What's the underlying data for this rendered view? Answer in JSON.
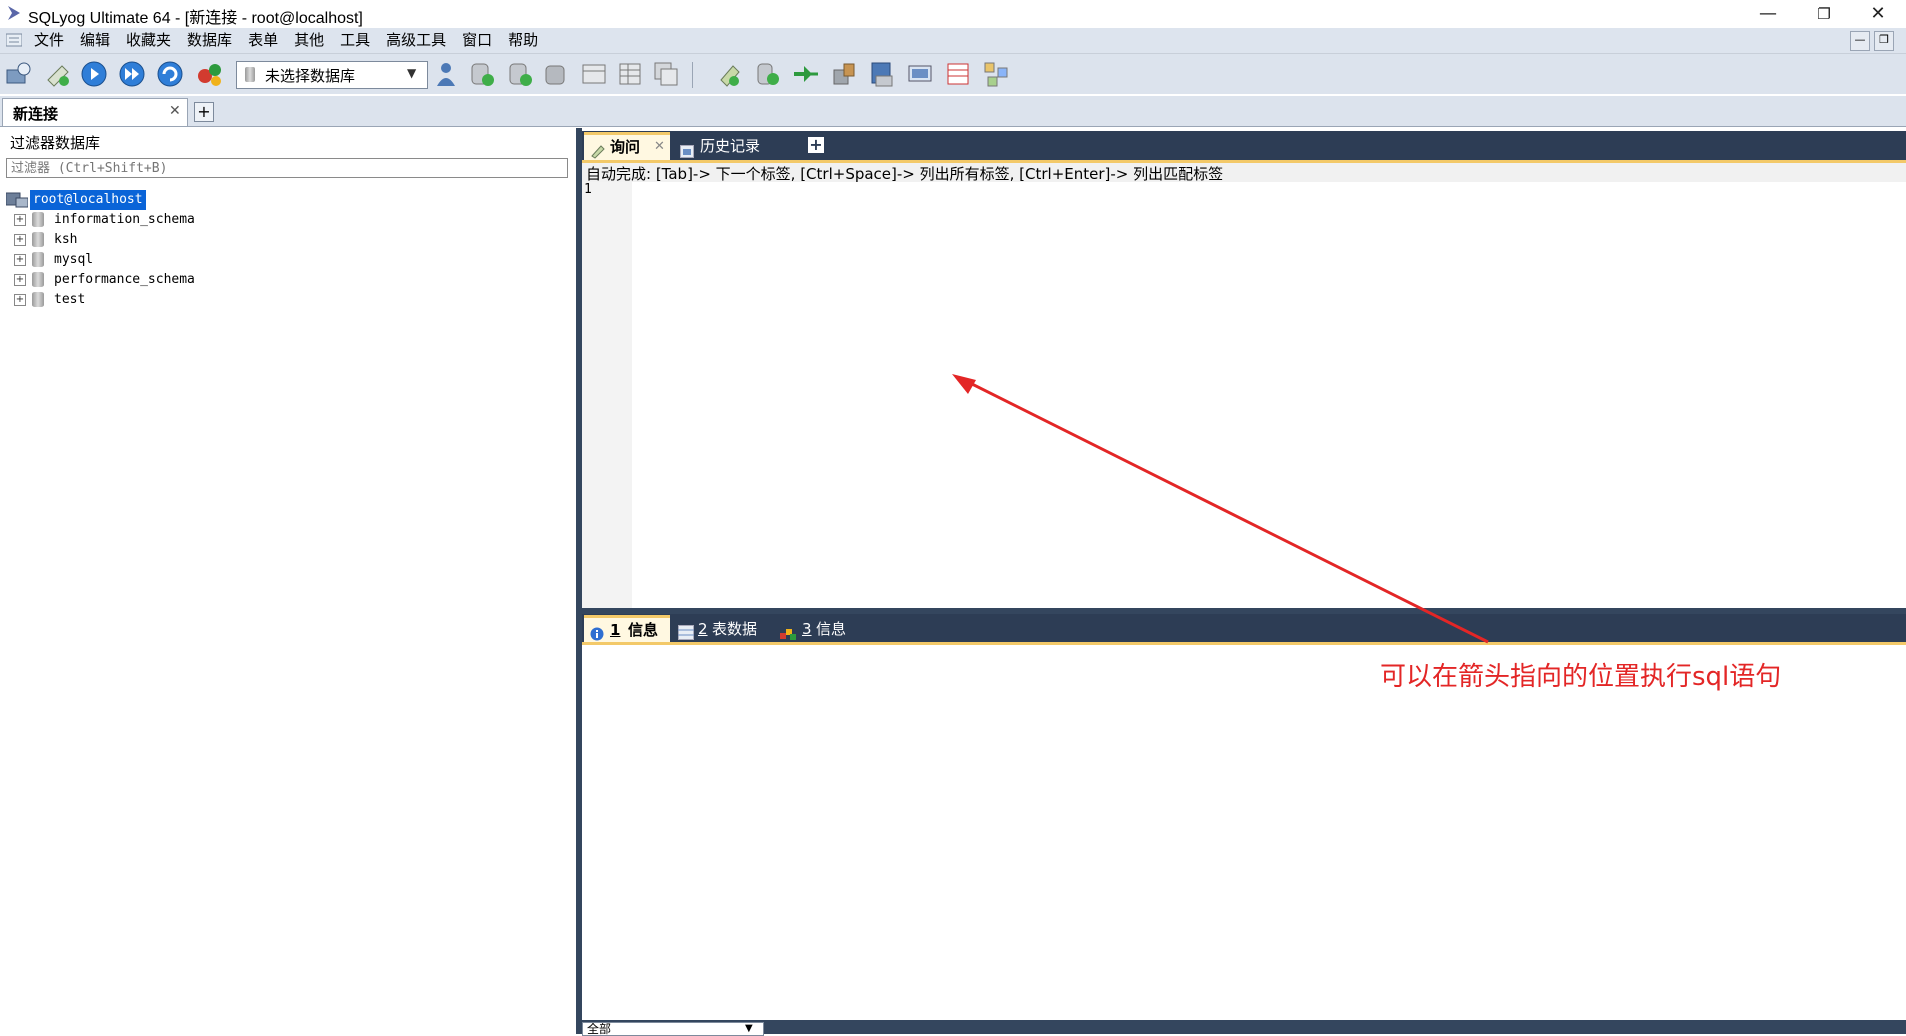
{
  "window": {
    "title": "SQLyog Ultimate 64 - [新连接 - root@localhost]"
  },
  "menu": [
    "文件",
    "编辑",
    "收藏夹",
    "数据库",
    "表单",
    "其他",
    "工具",
    "高级工具",
    "窗口",
    "帮助"
  ],
  "toolbar": {
    "db_select_value": "未选择数据库"
  },
  "connection_tab": {
    "label": "新连接",
    "close": "✕",
    "add": "+"
  },
  "left_panel": {
    "title": "过滤器数据库",
    "filter_placeholder": "过滤器 (Ctrl+Shift+B)",
    "root_node": "root@localhost",
    "databases": [
      "information_schema",
      "ksh",
      "mysql",
      "performance_schema",
      "test"
    ]
  },
  "query_tabs": [
    {
      "label": "询问",
      "close": "✕"
    },
    {
      "label": "历史记录"
    }
  ],
  "query_tab_add": "+",
  "editor": {
    "hint": "自动完成: [Tab]-> 下一个标签, [Ctrl+Space]-> 列出所有标签, [Ctrl+Enter]-> 列出匹配标签",
    "line_number": "1"
  },
  "result_tabs": [
    {
      "num": "1",
      "label": "信息"
    },
    {
      "num": "2",
      "label": "表数据"
    },
    {
      "num": "3",
      "label": "信息"
    }
  ],
  "bottom_select": "全部",
  "annotation": {
    "text": "可以在箭头指向的位置执行sql语句",
    "color": "#e32626"
  }
}
